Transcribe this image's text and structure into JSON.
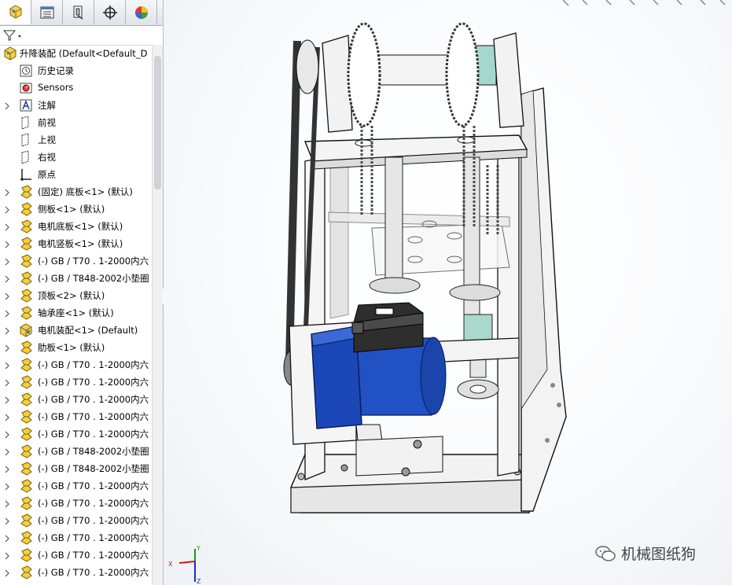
{
  "tabs": [
    {
      "name": "featuremanager-tab",
      "icon": "featuremanager-icon"
    },
    {
      "name": "propertymanager-tab",
      "icon": "propertymanager-icon"
    },
    {
      "name": "configurationmanager-tab",
      "icon": "configurationmanager-icon"
    },
    {
      "name": "dimxpert-tab",
      "icon": "crosshair-icon"
    },
    {
      "name": "display-manager-tab",
      "icon": "display-pie-icon"
    }
  ],
  "filter": {
    "icon": "filter-icon"
  },
  "tree": {
    "root": {
      "label": "升降装配  (Default<Default_D",
      "icon": "assembly-icon"
    },
    "items": [
      {
        "label": "历史记录",
        "icon": "history-icon",
        "expandable": false
      },
      {
        "label": "Sensors",
        "icon": "sensor-icon",
        "expandable": false
      },
      {
        "label": "注解",
        "icon": "annotations-icon",
        "expandable": true
      },
      {
        "label": "前视",
        "icon": "plane-icon",
        "expandable": false
      },
      {
        "label": "上视",
        "icon": "plane-icon",
        "expandable": false
      },
      {
        "label": "右视",
        "icon": "plane-icon",
        "expandable": false
      },
      {
        "label": "原点",
        "icon": "origin-icon",
        "expandable": false
      },
      {
        "label": "(固定) 底板<1> (默认)",
        "icon": "part-icon",
        "expandable": true
      },
      {
        "label": "侧板<1> (默认)",
        "icon": "part-icon",
        "expandable": true
      },
      {
        "label": "电机底板<1> (默认)",
        "icon": "part-icon",
        "expandable": true
      },
      {
        "label": "电机竖板<1> (默认)",
        "icon": "part-icon",
        "expandable": true
      },
      {
        "label": "(-) GB / T70 . 1-2000内六",
        "icon": "part-icon",
        "expandable": true
      },
      {
        "label": "(-) GB / T848-2002小垫圈",
        "icon": "part-icon",
        "expandable": true
      },
      {
        "label": "顶板<2> (默认)",
        "icon": "part-icon",
        "expandable": true
      },
      {
        "label": "轴承座<1> (默认)",
        "icon": "part-icon",
        "expandable": true
      },
      {
        "label": "电机装配<1> (Default)",
        "icon": "subassembly-icon",
        "expandable": true
      },
      {
        "label": "肋板<1> (默认)",
        "icon": "part-icon",
        "expandable": true
      },
      {
        "label": "(-) GB / T70 . 1-2000内六",
        "icon": "part-icon",
        "expandable": true
      },
      {
        "label": "(-) GB / T70 . 1-2000内六",
        "icon": "part-icon",
        "expandable": true
      },
      {
        "label": "(-) GB / T70 . 1-2000内六",
        "icon": "part-icon",
        "expandable": true
      },
      {
        "label": "(-) GB / T70 . 1-2000内六",
        "icon": "part-icon",
        "expandable": true
      },
      {
        "label": "(-) GB / T70 . 1-2000内六",
        "icon": "part-icon",
        "expandable": true
      },
      {
        "label": "(-) GB / T848-2002小垫圈",
        "icon": "part-icon",
        "expandable": true
      },
      {
        "label": "(-) GB / T848-2002小垫圈",
        "icon": "part-icon",
        "expandable": true
      },
      {
        "label": "(-) GB / T70 . 1-2000内六",
        "icon": "part-icon",
        "expandable": true
      },
      {
        "label": "(-) GB / T70 . 1-2000内六",
        "icon": "part-icon",
        "expandable": true
      },
      {
        "label": "(-) GB / T70 . 1-2000内六",
        "icon": "part-icon",
        "expandable": true
      },
      {
        "label": "(-) GB / T70 . 1-2000内六",
        "icon": "part-icon",
        "expandable": true
      },
      {
        "label": "(-) GB / T70 . 1-2000内六",
        "icon": "part-icon",
        "expandable": true
      },
      {
        "label": "(-) GB / T70 . 1-2000内六",
        "icon": "part-icon",
        "expandable": true
      }
    ]
  },
  "triad": {
    "x_label": "X",
    "y_label": "Y",
    "z_label": "Z"
  },
  "watermark": {
    "text": "机械图纸狗",
    "icon": "wechat-icon"
  },
  "colors": {
    "motor_blue": "#1f4fc0",
    "frame": "#f4f4f4",
    "chain": "#555555",
    "gearbox": "#3a3a3a",
    "coupling": "#9fd3c8"
  }
}
